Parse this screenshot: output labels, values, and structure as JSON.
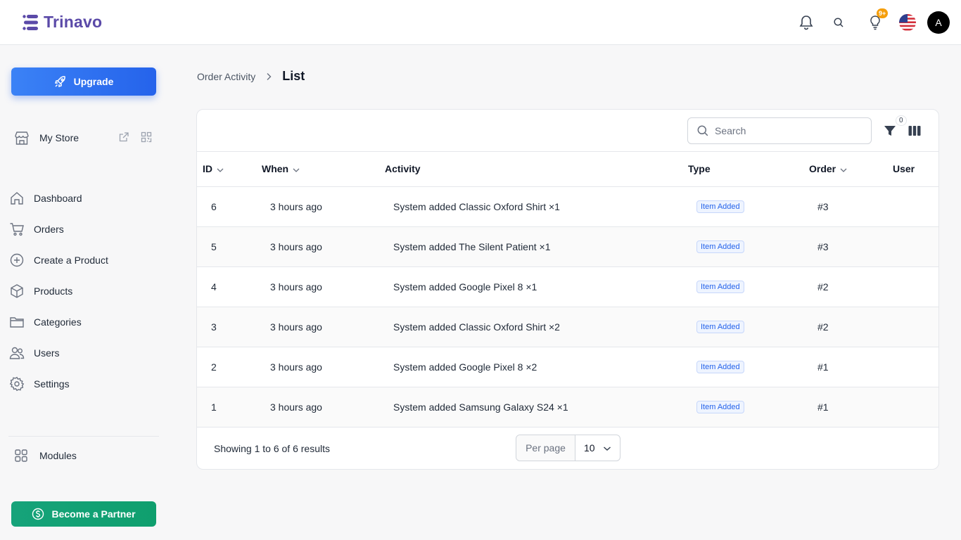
{
  "brand": {
    "name": "Trinavo",
    "color": "#5b4aa8"
  },
  "header": {
    "notifications_badge": "9+",
    "avatar_initial": "A"
  },
  "sidebar": {
    "upgrade_label": "Upgrade",
    "store_label": "My Store",
    "items": [
      {
        "label": "Dashboard",
        "icon": "home-icon"
      },
      {
        "label": "Orders",
        "icon": "cart-icon"
      },
      {
        "label": "Create a Product",
        "icon": "plus-circle-icon"
      },
      {
        "label": "Products",
        "icon": "box-icon"
      },
      {
        "label": "Categories",
        "icon": "folder-icon"
      },
      {
        "label": "Users",
        "icon": "users-icon"
      },
      {
        "label": "Settings",
        "icon": "gear-icon"
      }
    ],
    "modules_label": "Modules",
    "partner_label": "Become a Partner"
  },
  "breadcrumb": {
    "parent": "Order Activity",
    "current": "List"
  },
  "toolbar": {
    "search_placeholder": "Search",
    "filter_count": "0"
  },
  "table": {
    "columns": [
      "ID",
      "When",
      "Activity",
      "Type",
      "Order",
      "User"
    ],
    "rows": [
      {
        "id": "6",
        "when": "3 hours ago",
        "activity": "System added Classic Oxford Shirt ×1",
        "type": "Item Added",
        "order": "#3",
        "user": ""
      },
      {
        "id": "5",
        "when": "3 hours ago",
        "activity": "System added The Silent Patient ×1",
        "type": "Item Added",
        "order": "#3",
        "user": ""
      },
      {
        "id": "4",
        "when": "3 hours ago",
        "activity": "System added Google Pixel 8 ×1",
        "type": "Item Added",
        "order": "#2",
        "user": ""
      },
      {
        "id": "3",
        "when": "3 hours ago",
        "activity": "System added Classic Oxford Shirt ×2",
        "type": "Item Added",
        "order": "#2",
        "user": ""
      },
      {
        "id": "2",
        "when": "3 hours ago",
        "activity": "System added Google Pixel 8 ×2",
        "type": "Item Added",
        "order": "#1",
        "user": ""
      },
      {
        "id": "1",
        "when": "3 hours ago",
        "activity": "System added Samsung Galaxy S24 ×1",
        "type": "Item Added",
        "order": "#1",
        "user": ""
      }
    ]
  },
  "footer": {
    "showing": "Showing 1 to 6 of 6 results",
    "per_page_label": "Per page",
    "per_page_value": "10"
  }
}
